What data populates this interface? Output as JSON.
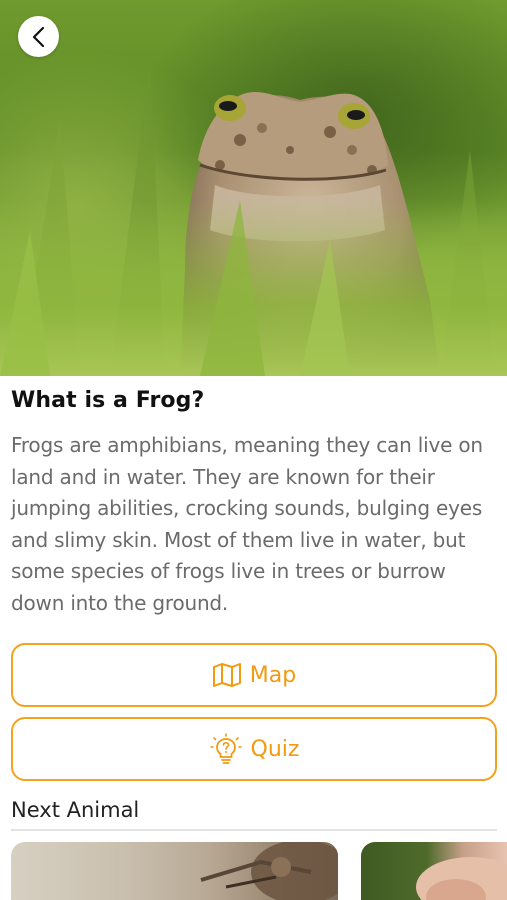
{
  "header": {
    "back_icon": "chevron-left-icon"
  },
  "article": {
    "title": "What is a Frog?",
    "description": "Frogs are amphibians, meaning they can live on land and in water. They are known for their jumping abilities, crocking sounds, bulging eyes and slimy skin. Most of them live in water, but some species of frogs live in trees or burrow down into the ground."
  },
  "actions": {
    "map": {
      "label": "Map",
      "icon": "map-icon"
    },
    "quiz": {
      "label": "Quiz",
      "icon": "lightbulb-icon"
    }
  },
  "next_section": {
    "heading": "Next Animal"
  },
  "colors": {
    "accent": "#f29a10",
    "text_primary": "#111111",
    "text_secondary": "#6b6b6b"
  }
}
